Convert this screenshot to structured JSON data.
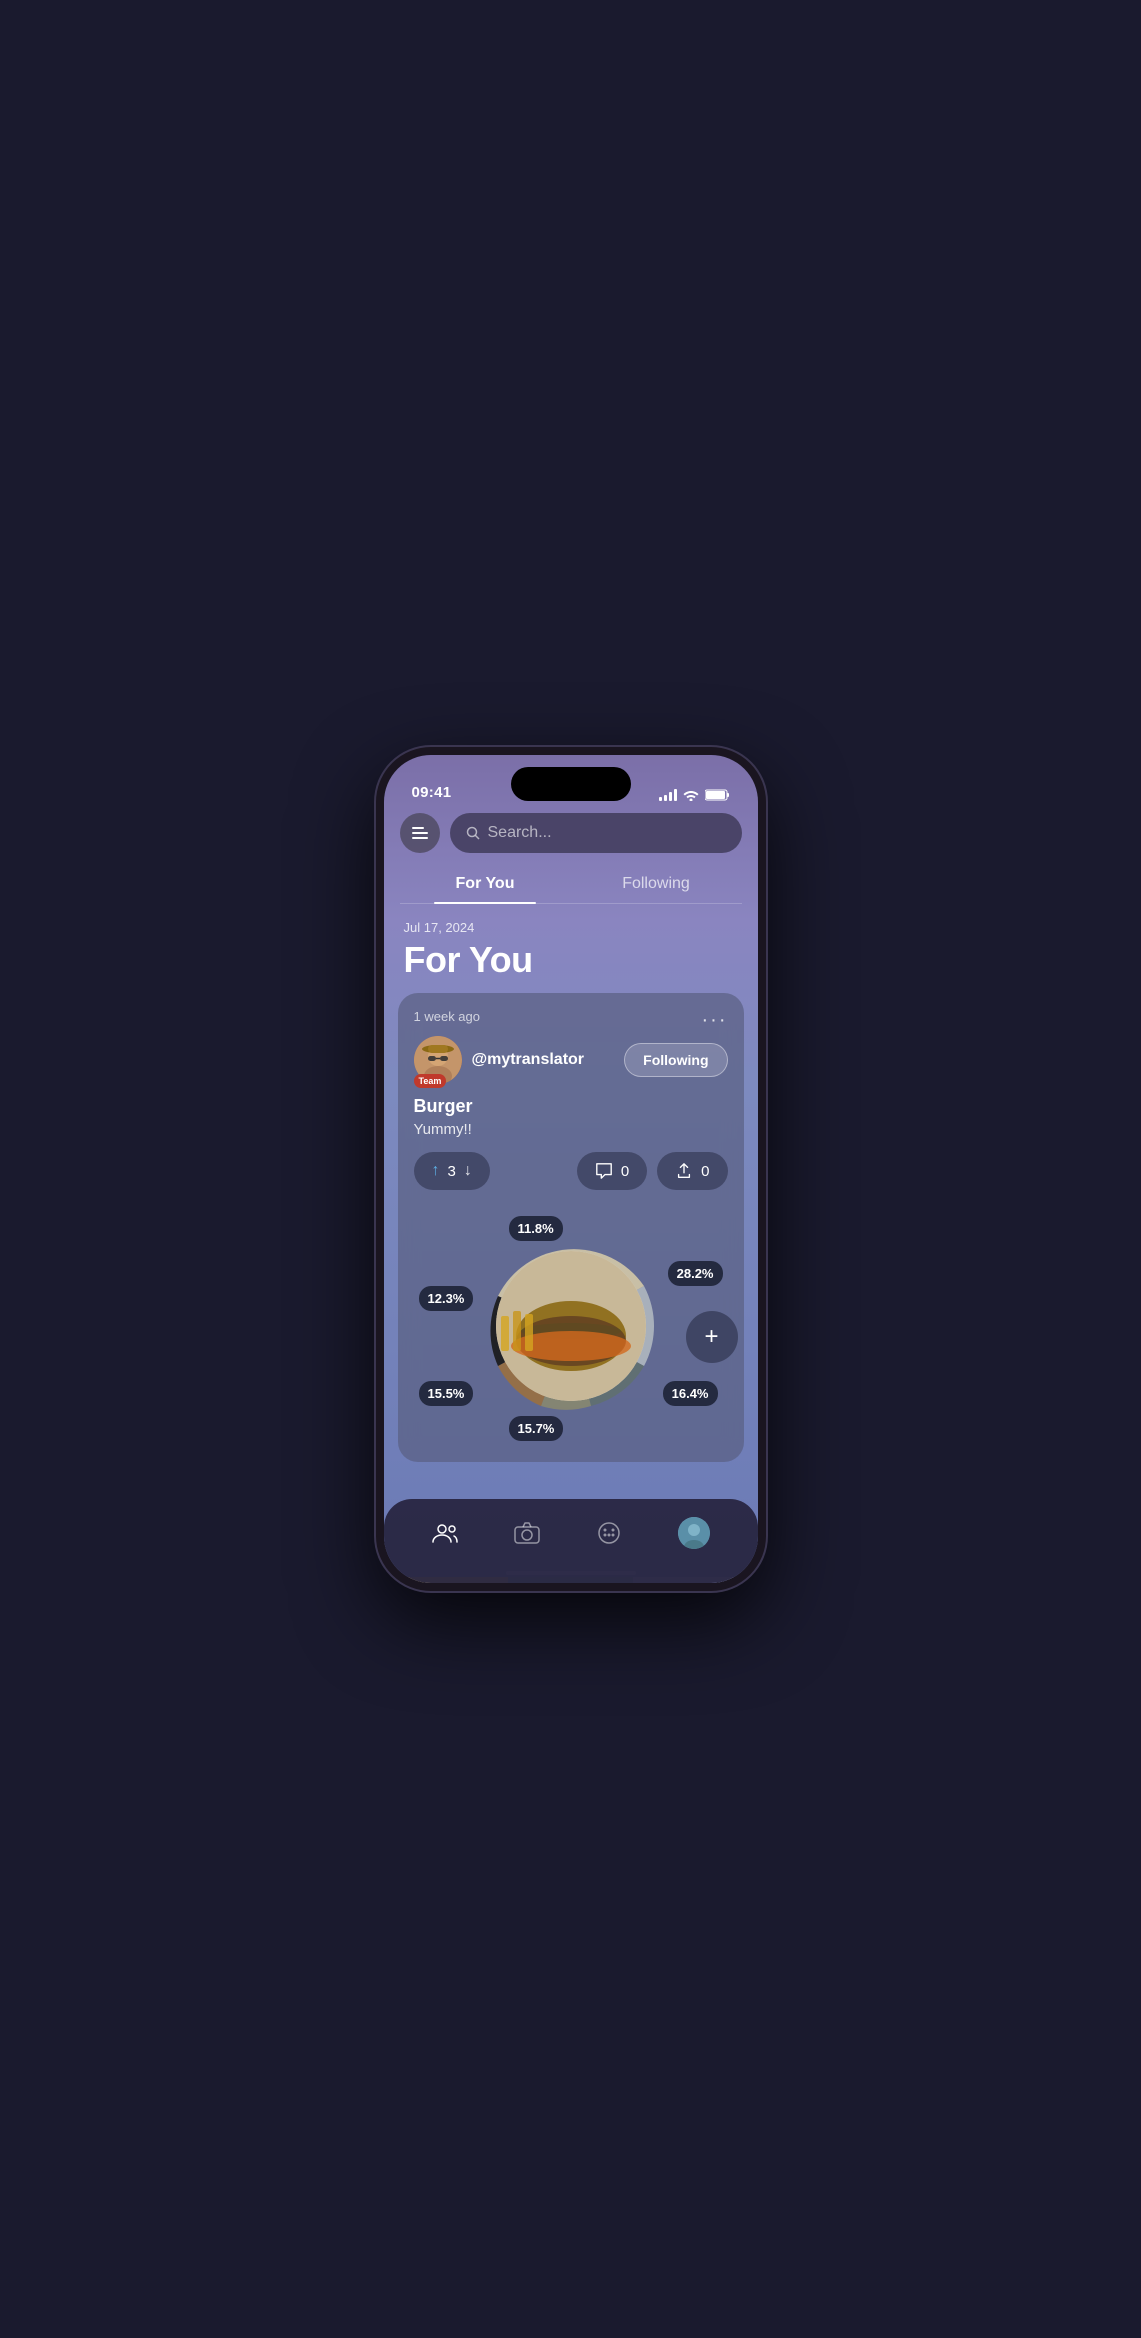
{
  "status": {
    "time": "09:41",
    "signal": [
      25,
      50,
      75,
      100
    ],
    "wifi": true,
    "battery": true
  },
  "header": {
    "search_placeholder": "Search...",
    "menu_label": "Menu"
  },
  "tabs": [
    {
      "id": "for-you",
      "label": "For You",
      "active": true
    },
    {
      "id": "following",
      "label": "Following",
      "active": false
    }
  ],
  "section": {
    "date": "Jul 17, 2024",
    "title": "For You"
  },
  "post": {
    "timestamp": "1 week ago",
    "author_handle": "@mytranslator",
    "author_badge": "Team",
    "following_label": "Following",
    "more_label": "···",
    "title": "Burger",
    "subtitle": "Yummy!!",
    "votes": {
      "count": 3,
      "up_icon": "↑",
      "down_icon": "↓"
    },
    "comments": {
      "count": 0
    },
    "shares": {
      "count": 0
    }
  },
  "chart": {
    "segments": [
      {
        "label": "11.8%",
        "value": 11.8,
        "color": "#d4c9a8",
        "pos": "top"
      },
      {
        "label": "28.2%",
        "value": 28.2,
        "color": "#b0b8c0",
        "pos": "right"
      },
      {
        "label": "16.4%",
        "value": 16.4,
        "color": "#607070",
        "pos": "bottom-right"
      },
      {
        "label": "15.7%",
        "value": 15.7,
        "color": "#888870",
        "pos": "bottom"
      },
      {
        "label": "15.5%",
        "value": 15.5,
        "color": "#9a7040",
        "pos": "bottom-left"
      },
      {
        "label": "12.3%",
        "value": 12.3,
        "color": "#1a1a1a",
        "pos": "left"
      }
    ]
  },
  "fab": {
    "label": "+"
  },
  "bottom_nav": [
    {
      "id": "community",
      "icon": "👥",
      "active": true
    },
    {
      "id": "camera",
      "icon": "📷",
      "active": false
    },
    {
      "id": "palette",
      "icon": "🎨",
      "active": false
    },
    {
      "id": "profile",
      "icon": "👤",
      "active": false
    }
  ]
}
